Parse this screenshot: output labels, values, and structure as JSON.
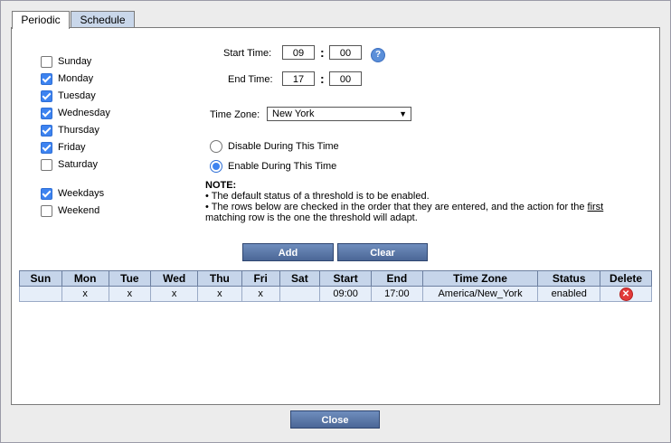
{
  "tabs": [
    {
      "label": "Periodic"
    },
    {
      "label": "Schedule"
    }
  ],
  "days": [
    {
      "label": "Sunday",
      "checked": false
    },
    {
      "label": "Monday",
      "checked": true
    },
    {
      "label": "Tuesday",
      "checked": true
    },
    {
      "label": "Wednesday",
      "checked": true
    },
    {
      "label": "Thursday",
      "checked": true
    },
    {
      "label": "Friday",
      "checked": true
    },
    {
      "label": "Saturday",
      "checked": false
    }
  ],
  "groups": [
    {
      "label": "Weekdays",
      "checked": true
    },
    {
      "label": "Weekend",
      "checked": false
    }
  ],
  "start_time": {
    "label": "Start Time:",
    "hour": "09",
    "minute": "00"
  },
  "end_time": {
    "label": "End Time:",
    "hour": "17",
    "minute": "00"
  },
  "colon": ":",
  "help_icon": "?",
  "timezone": {
    "label": "Time Zone:",
    "value": "New York"
  },
  "radios": [
    {
      "label": "Disable During This Time",
      "selected": false
    },
    {
      "label": "Enable During This Time",
      "selected": true
    }
  ],
  "note": {
    "title": "NOTE:",
    "line1": "• The default status of a threshold is to be enabled.",
    "line2a": "• The rows below are checked in the order that they are entered, and the action for the ",
    "line2_link": "first",
    "line2b": "matching row is the one the threshold will adapt."
  },
  "buttons": {
    "add": "Add",
    "clear": "Clear",
    "close": "Close"
  },
  "table": {
    "headers": [
      "Sun",
      "Mon",
      "Tue",
      "Wed",
      "Thu",
      "Fri",
      "Sat",
      "Start",
      "End",
      "Time Zone",
      "Status",
      "Delete"
    ],
    "rows": [
      [
        "",
        "x",
        "x",
        "x",
        "x",
        "x",
        "",
        "09:00",
        "17:00",
        "America/New_York",
        "enabled",
        "✕"
      ]
    ]
  }
}
